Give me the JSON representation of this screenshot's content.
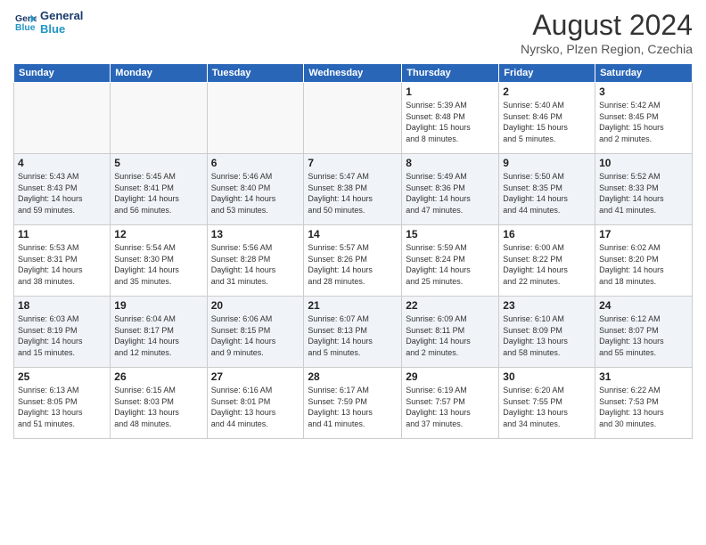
{
  "logo": {
    "line1": "General",
    "line2": "Blue"
  },
  "title": "August 2024",
  "location": "Nyrsko, Plzen Region, Czechia",
  "headers": [
    "Sunday",
    "Monday",
    "Tuesday",
    "Wednesday",
    "Thursday",
    "Friday",
    "Saturday"
  ],
  "weeks": [
    [
      {
        "day": "",
        "detail": ""
      },
      {
        "day": "",
        "detail": ""
      },
      {
        "day": "",
        "detail": ""
      },
      {
        "day": "",
        "detail": ""
      },
      {
        "day": "1",
        "detail": "Sunrise: 5:39 AM\nSunset: 8:48 PM\nDaylight: 15 hours\nand 8 minutes."
      },
      {
        "day": "2",
        "detail": "Sunrise: 5:40 AM\nSunset: 8:46 PM\nDaylight: 15 hours\nand 5 minutes."
      },
      {
        "day": "3",
        "detail": "Sunrise: 5:42 AM\nSunset: 8:45 PM\nDaylight: 15 hours\nand 2 minutes."
      }
    ],
    [
      {
        "day": "4",
        "detail": "Sunrise: 5:43 AM\nSunset: 8:43 PM\nDaylight: 14 hours\nand 59 minutes."
      },
      {
        "day": "5",
        "detail": "Sunrise: 5:45 AM\nSunset: 8:41 PM\nDaylight: 14 hours\nand 56 minutes."
      },
      {
        "day": "6",
        "detail": "Sunrise: 5:46 AM\nSunset: 8:40 PM\nDaylight: 14 hours\nand 53 minutes."
      },
      {
        "day": "7",
        "detail": "Sunrise: 5:47 AM\nSunset: 8:38 PM\nDaylight: 14 hours\nand 50 minutes."
      },
      {
        "day": "8",
        "detail": "Sunrise: 5:49 AM\nSunset: 8:36 PM\nDaylight: 14 hours\nand 47 minutes."
      },
      {
        "day": "9",
        "detail": "Sunrise: 5:50 AM\nSunset: 8:35 PM\nDaylight: 14 hours\nand 44 minutes."
      },
      {
        "day": "10",
        "detail": "Sunrise: 5:52 AM\nSunset: 8:33 PM\nDaylight: 14 hours\nand 41 minutes."
      }
    ],
    [
      {
        "day": "11",
        "detail": "Sunrise: 5:53 AM\nSunset: 8:31 PM\nDaylight: 14 hours\nand 38 minutes."
      },
      {
        "day": "12",
        "detail": "Sunrise: 5:54 AM\nSunset: 8:30 PM\nDaylight: 14 hours\nand 35 minutes."
      },
      {
        "day": "13",
        "detail": "Sunrise: 5:56 AM\nSunset: 8:28 PM\nDaylight: 14 hours\nand 31 minutes."
      },
      {
        "day": "14",
        "detail": "Sunrise: 5:57 AM\nSunset: 8:26 PM\nDaylight: 14 hours\nand 28 minutes."
      },
      {
        "day": "15",
        "detail": "Sunrise: 5:59 AM\nSunset: 8:24 PM\nDaylight: 14 hours\nand 25 minutes."
      },
      {
        "day": "16",
        "detail": "Sunrise: 6:00 AM\nSunset: 8:22 PM\nDaylight: 14 hours\nand 22 minutes."
      },
      {
        "day": "17",
        "detail": "Sunrise: 6:02 AM\nSunset: 8:20 PM\nDaylight: 14 hours\nand 18 minutes."
      }
    ],
    [
      {
        "day": "18",
        "detail": "Sunrise: 6:03 AM\nSunset: 8:19 PM\nDaylight: 14 hours\nand 15 minutes."
      },
      {
        "day": "19",
        "detail": "Sunrise: 6:04 AM\nSunset: 8:17 PM\nDaylight: 14 hours\nand 12 minutes."
      },
      {
        "day": "20",
        "detail": "Sunrise: 6:06 AM\nSunset: 8:15 PM\nDaylight: 14 hours\nand 9 minutes."
      },
      {
        "day": "21",
        "detail": "Sunrise: 6:07 AM\nSunset: 8:13 PM\nDaylight: 14 hours\nand 5 minutes."
      },
      {
        "day": "22",
        "detail": "Sunrise: 6:09 AM\nSunset: 8:11 PM\nDaylight: 14 hours\nand 2 minutes."
      },
      {
        "day": "23",
        "detail": "Sunrise: 6:10 AM\nSunset: 8:09 PM\nDaylight: 13 hours\nand 58 minutes."
      },
      {
        "day": "24",
        "detail": "Sunrise: 6:12 AM\nSunset: 8:07 PM\nDaylight: 13 hours\nand 55 minutes."
      }
    ],
    [
      {
        "day": "25",
        "detail": "Sunrise: 6:13 AM\nSunset: 8:05 PM\nDaylight: 13 hours\nand 51 minutes."
      },
      {
        "day": "26",
        "detail": "Sunrise: 6:15 AM\nSunset: 8:03 PM\nDaylight: 13 hours\nand 48 minutes."
      },
      {
        "day": "27",
        "detail": "Sunrise: 6:16 AM\nSunset: 8:01 PM\nDaylight: 13 hours\nand 44 minutes."
      },
      {
        "day": "28",
        "detail": "Sunrise: 6:17 AM\nSunset: 7:59 PM\nDaylight: 13 hours\nand 41 minutes."
      },
      {
        "day": "29",
        "detail": "Sunrise: 6:19 AM\nSunset: 7:57 PM\nDaylight: 13 hours\nand 37 minutes."
      },
      {
        "day": "30",
        "detail": "Sunrise: 6:20 AM\nSunset: 7:55 PM\nDaylight: 13 hours\nand 34 minutes."
      },
      {
        "day": "31",
        "detail": "Sunrise: 6:22 AM\nSunset: 7:53 PM\nDaylight: 13 hours\nand 30 minutes."
      }
    ]
  ]
}
